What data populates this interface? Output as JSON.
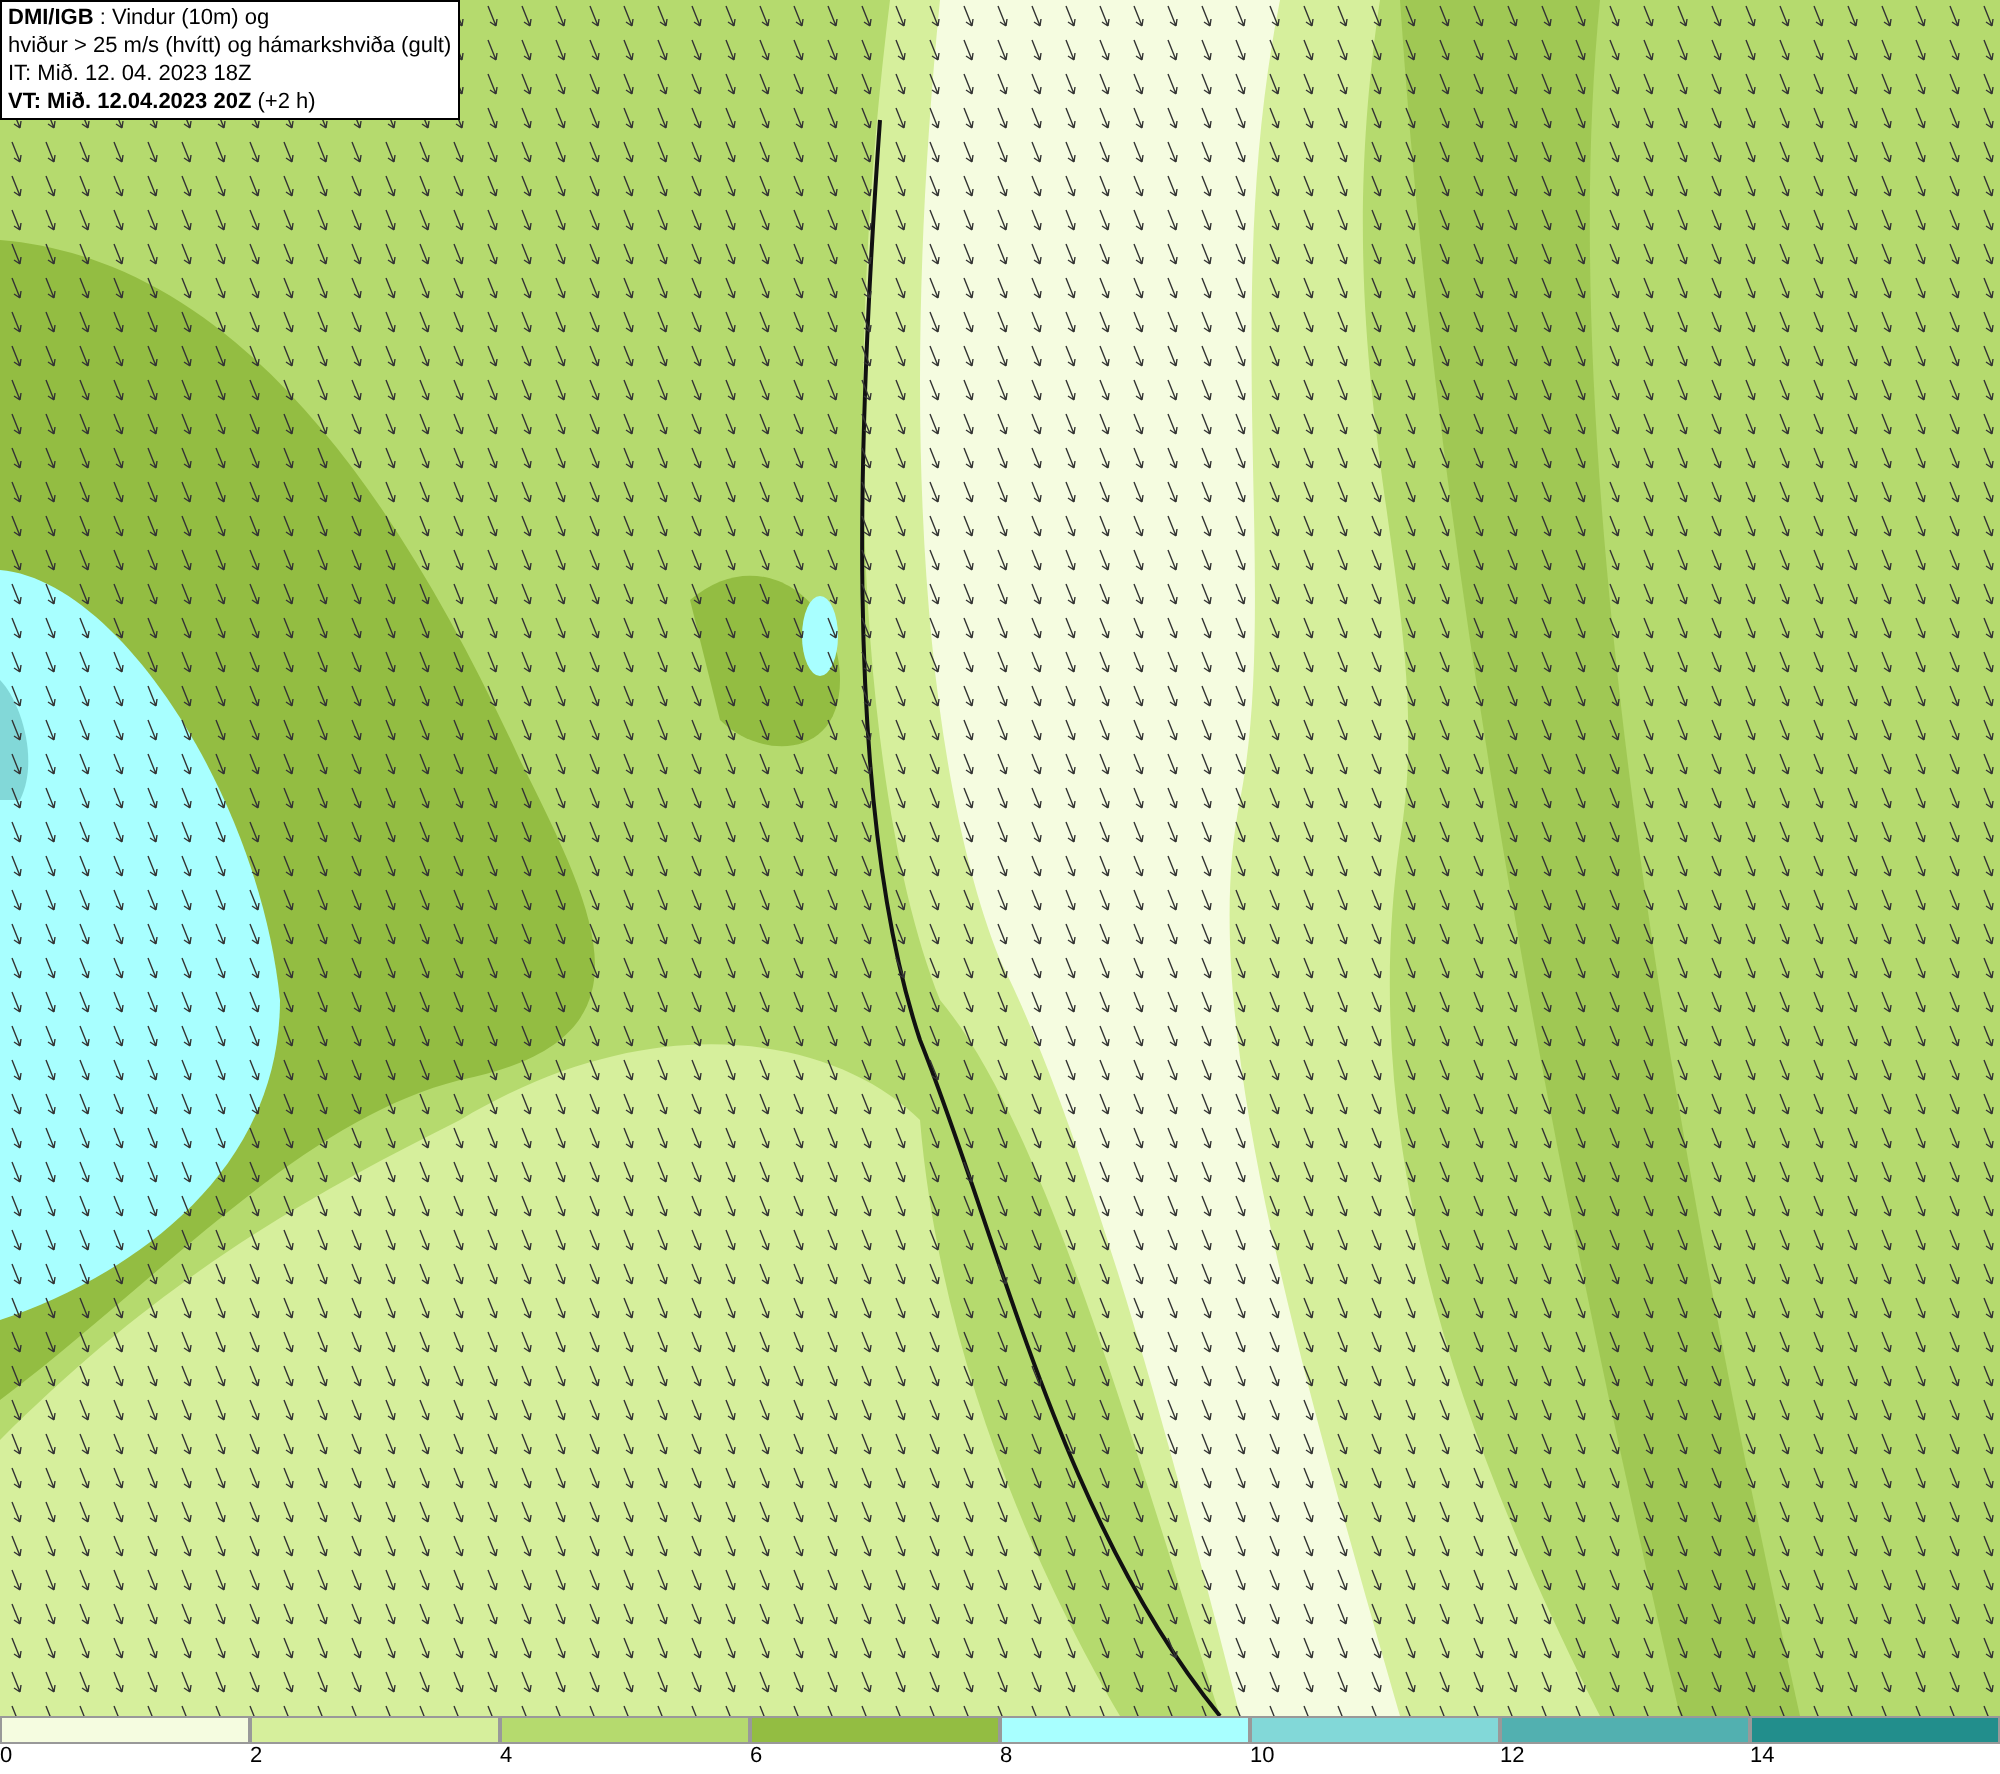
{
  "title_box": {
    "lines": [
      "**DMI/IGB** : Vindur (10m) og",
      "hviður > 25 m/s (hvítt) og hámarkshviða (gult)",
      "IT: Mið. 12. 04. 2023 18Z",
      "**VT: Mið. 12.04.2023 20Z** (+2 h)"
    ]
  },
  "legend": [
    {
      "label": "0",
      "color": "#f5fce0"
    },
    {
      "label": "2",
      "color": "#d6ef9c"
    },
    {
      "label": "4",
      "color": "#b5da6e"
    },
    {
      "label": "6",
      "color": "#93bd42"
    },
    {
      "label": "8",
      "color": "#a8ffff"
    },
    {
      "label": "10",
      "color": "#82d8d8"
    },
    {
      "label": "12",
      "color": "#52b0b0"
    },
    {
      "label": "14",
      "color": "#228e8c"
    }
  ]
}
